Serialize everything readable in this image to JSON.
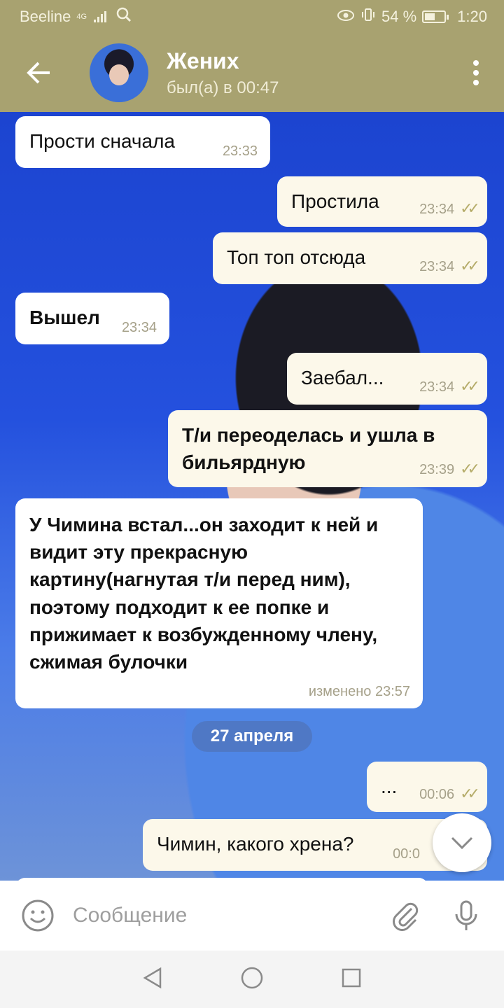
{
  "status_bar": {
    "carrier": "Beeline",
    "network": "4G",
    "battery": "54 %",
    "battery_level": 0.54,
    "time": "1:20"
  },
  "header": {
    "title": "Жених",
    "status": "был(а) в 00:47",
    "back_icon": "arrow-left-icon",
    "menu_icon": "more-vertical-icon"
  },
  "messages": [
    {
      "dir": "in",
      "text": "Прости сначала",
      "time": "23:33"
    },
    {
      "dir": "out",
      "text": "Простила",
      "time": "23:34"
    },
    {
      "dir": "out",
      "text": "Топ топ отсюда",
      "time": "23:34"
    },
    {
      "dir": "in",
      "text": "Вышел",
      "time": "23:34"
    },
    {
      "dir": "out",
      "text": "Заебал...",
      "time": "23:34"
    },
    {
      "dir": "out",
      "text": "Т/и переоделась и ушла в бильярдную",
      "time": "23:39"
    },
    {
      "dir": "in",
      "text": "У Чимина встал...он заходит к ней и видит эту прекрасную картину(нагнутая т/и перед ним), поэтому подходит к ее попке и прижимает к возбужденному члену, сжимая булочки",
      "time": "изменено 23:57"
    },
    {
      "dir": "out",
      "text": "...",
      "time": "00:06"
    },
    {
      "dir": "out",
      "text": "Чимин, какого хрена?",
      "time": "00:0"
    }
  ],
  "date_separator": "27 апреля",
  "input": {
    "placeholder": "Сообщение"
  },
  "colors": {
    "header": "#a8a270",
    "bubble_out": "#fcf8ea",
    "bubble_in": "#ffffff",
    "check": "#b5ac6a"
  }
}
